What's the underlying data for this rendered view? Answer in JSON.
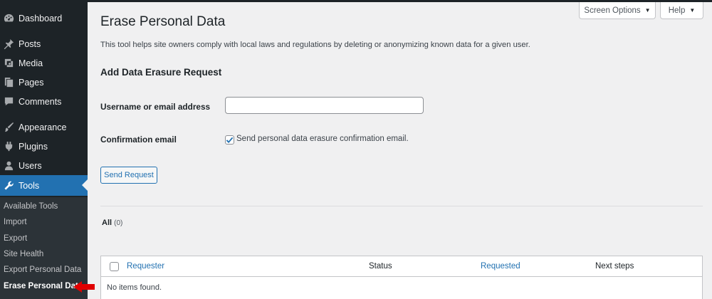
{
  "sidebar": {
    "items": [
      {
        "label": "Dashboard",
        "icon": "dashboard-icon"
      },
      {
        "label": "Posts",
        "icon": "pin-icon"
      },
      {
        "label": "Media",
        "icon": "media-icon"
      },
      {
        "label": "Pages",
        "icon": "pages-icon"
      },
      {
        "label": "Comments",
        "icon": "comment-icon"
      },
      {
        "label": "Appearance",
        "icon": "brush-icon"
      },
      {
        "label": "Plugins",
        "icon": "plugin-icon"
      },
      {
        "label": "Users",
        "icon": "user-icon"
      },
      {
        "label": "Tools",
        "icon": "wrench-icon"
      }
    ],
    "submenu": [
      "Available Tools",
      "Import",
      "Export",
      "Site Health",
      "Export Personal Data",
      "Erase Personal Data"
    ],
    "active_color": "#2271b1"
  },
  "header": {
    "screen_options": "Screen Options",
    "help": "Help"
  },
  "page": {
    "title": "Erase Personal Data",
    "description": "This tool helps site owners comply with local laws and regulations by deleting or anonymizing known data for a given user."
  },
  "form": {
    "section_title": "Add Data Erasure Request",
    "username_label": "Username or email address",
    "username_value": "",
    "confirmation_label": "Confirmation email",
    "confirmation_text": "Send personal data erasure confirmation email.",
    "confirmation_checked": true,
    "send_button": "Send Request"
  },
  "filters": {
    "all_label": "All",
    "all_count": "(0)"
  },
  "table": {
    "columns": [
      "Requester",
      "Status",
      "Requested",
      "Next steps"
    ],
    "empty_message": "No items found."
  }
}
